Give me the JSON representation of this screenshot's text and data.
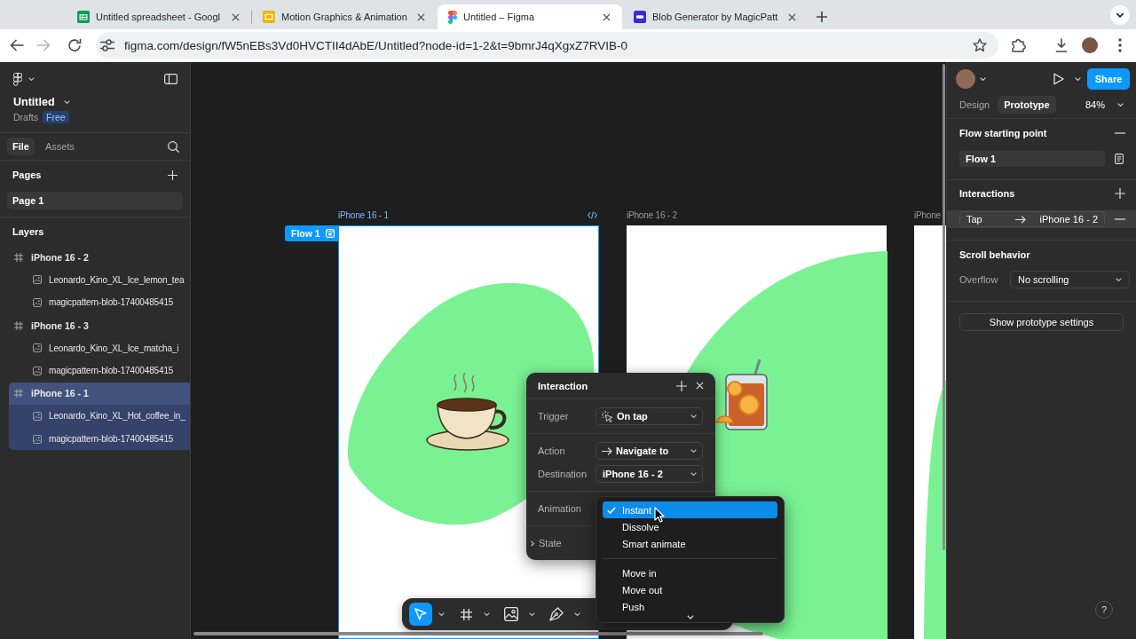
{
  "browser": {
    "tabs": [
      {
        "kind": "sheets",
        "title": "Untitled spreadsheet - Googl",
        "selected": false
      },
      {
        "kind": "slides",
        "title": "Motion Graphics & Animation",
        "selected": false
      },
      {
        "kind": "figma",
        "title": "Untitled – Figma",
        "selected": true
      },
      {
        "kind": "blob",
        "title": "Blob Generator by MagicPatt",
        "selected": false
      }
    ],
    "address": "figma.com/design/fW5nEBs3Vd0HVCTII4dAbE/Untitled?node-id=1-2&t=9bmrJ4qXgxZ7RVIB-0"
  },
  "sidebar": {
    "file_name": "Untitled",
    "location": "Drafts",
    "plan": "Free",
    "tabs": [
      {
        "label": "File",
        "selected": true
      },
      {
        "label": "Assets",
        "selected": false
      }
    ],
    "pages_heading": "Pages",
    "pages": [
      {
        "label": "Page 1",
        "selected": true
      }
    ],
    "layers_heading": "Layers",
    "layers": [
      {
        "name": "iPhone 16 - 2",
        "kind": "frame",
        "selected": false,
        "children": [
          {
            "name": "Leonardo_Kino_XL_Ice_lemon_tea",
            "kind": "image",
            "selected": false
          },
          {
            "name": "magicpattern-blob-17400485415",
            "kind": "image",
            "selected": false
          }
        ]
      },
      {
        "name": "iPhone 16 - 3",
        "kind": "frame",
        "selected": false,
        "children": [
          {
            "name": "Leonardo_Kino_XL_Ice_matcha_i",
            "kind": "image",
            "selected": false
          },
          {
            "name": "magicpattern-blob-17400485415",
            "kind": "image",
            "selected": false
          }
        ]
      },
      {
        "name": "iPhone 16 - 1",
        "kind": "frame",
        "selected": true,
        "children": [
          {
            "name": "Leonardo_Kino_XL_Hot_coffee_in_",
            "kind": "image",
            "selected": true
          },
          {
            "name": "magicpattern-blob-17400485415",
            "kind": "image",
            "selected": true
          }
        ]
      }
    ]
  },
  "canvas": {
    "frames": [
      {
        "label": "iPhone 16 - 1",
        "kind": "coffee",
        "selected": true,
        "flow_badge": "Flow 1"
      },
      {
        "label": "iPhone 16 - 2",
        "kind": "drink",
        "selected": false
      },
      {
        "label": "iPhone",
        "kind": "partial",
        "selected": false
      }
    ],
    "interaction_panel": {
      "title": "Interaction",
      "sections": [
        {
          "rows": [
            {
              "label": "Trigger",
              "kind": "tap",
              "value": "On tap"
            }
          ]
        },
        {
          "rows": [
            {
              "label": "Action",
              "kind": "navigate",
              "value": "Navigate to"
            },
            {
              "label": "Destination",
              "kind": "plain",
              "value": "iPhone 16 - 2"
            }
          ]
        },
        {
          "rows": [
            {
              "label": "Animation",
              "kind": "covered"
            }
          ]
        },
        {
          "rows": [
            {
              "label": "State",
              "kind": "toggle",
              "expanded": false
            }
          ]
        }
      ]
    },
    "animation_menu": {
      "groups": [
        {
          "items": [
            {
              "label": "Instant",
              "selected": true
            },
            {
              "label": "Dissolve",
              "selected": false
            },
            {
              "label": "Smart animate",
              "selected": false
            }
          ]
        },
        {
          "items": [
            {
              "label": "Move in",
              "selected": false
            },
            {
              "label": "Move out",
              "selected": false
            },
            {
              "label": "Push",
              "selected": false
            }
          ]
        }
      ]
    },
    "toolbar": {
      "tools": [
        {
          "kind": "move",
          "selected": true
        },
        {
          "kind": "frame",
          "selected": false
        },
        {
          "kind": "image",
          "selected": false
        },
        {
          "kind": "pen",
          "selected": false
        }
      ]
    }
  },
  "right_panel": {
    "share": "Share",
    "tabs": [
      {
        "label": "Design",
        "selected": false
      },
      {
        "label": "Prototype",
        "selected": true
      }
    ],
    "zoom": "84%",
    "flow_start": {
      "heading": "Flow starting point",
      "flow": "Flow 1"
    },
    "interactions": {
      "heading": "Interactions",
      "items": [
        {
          "trigger": "Tap",
          "destination": "iPhone 16 - 2",
          "selected": true
        }
      ]
    },
    "scroll": {
      "heading": "Scroll behavior",
      "label": "Overflow",
      "value": "No scrolling"
    },
    "settings_button": "Show prototype settings",
    "help_button": "?"
  }
}
